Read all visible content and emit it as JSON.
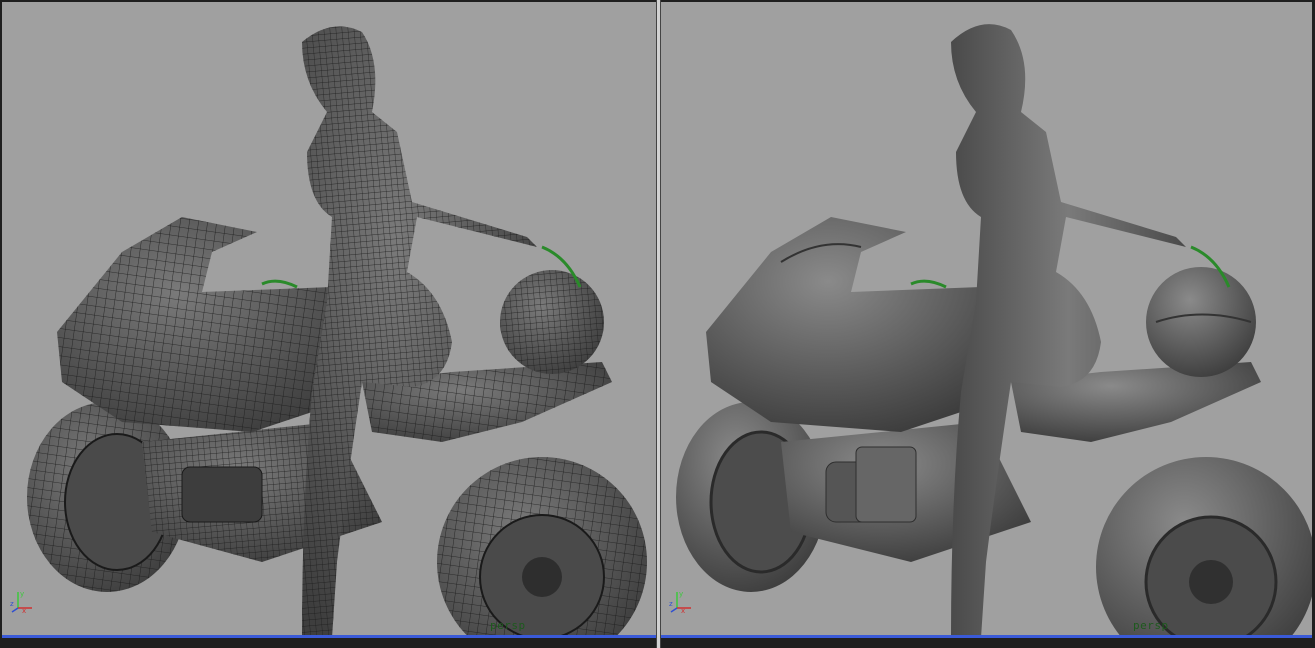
{
  "viewports": [
    {
      "id": "left",
      "shading": "wireframe-on-shaded",
      "camera_label": "persp",
      "axis": {
        "x": "x",
        "y": "y",
        "z": "z"
      }
    },
    {
      "id": "right",
      "shading": "smooth-shaded",
      "camera_label": "persp",
      "axis": {
        "x": "x",
        "y": "y",
        "z": "z"
      }
    }
  ],
  "colors": {
    "viewport_bg": "#a0a0a0",
    "model_fill": "#5a5a5a",
    "wire": "#1e1e1e",
    "active_border": "#3a5ad8",
    "selection_green": "#2a8a2a"
  }
}
